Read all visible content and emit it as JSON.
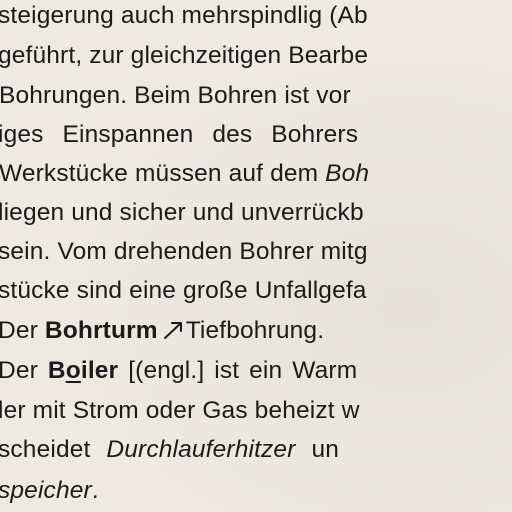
{
  "lines": [
    {
      "id": 0,
      "segments": [
        "steigerung auch mehrspindlig (Ab"
      ]
    },
    {
      "id": 1,
      "segments": [
        "geführt, zur gleichzeitigen Bearbe"
      ]
    },
    {
      "id": 2,
      "segments": [
        "Bohrungen. Beim Bohren ist vor"
      ]
    },
    {
      "id": 3,
      "segments": [
        "iges Einspannen des Bohrers"
      ]
    },
    {
      "id": 4,
      "segments": [
        "Werkstücke müssen auf dem ",
        "Boh"
      ]
    },
    {
      "id": 5,
      "segments": [
        "liegen und sicher und unverrückb"
      ]
    },
    {
      "id": 6,
      "segments": [
        "sein. Vom drehenden Bohrer mitg"
      ]
    },
    {
      "id": 7,
      "segments": [
        "stücke sind eine große Unfallgefa"
      ]
    },
    {
      "id": 8,
      "segments": [
        "Der ",
        "Bohrturm",
        "Tiefbohrung."
      ]
    },
    {
      "id": 9,
      "segments": [
        "Der ",
        "B",
        "o",
        "iler",
        " [(engl.] ist ein Warm"
      ]
    },
    {
      "id": 10,
      "segments": [
        "ler mit Strom oder Gas beheizt w"
      ]
    },
    {
      "id": 11,
      "segments": [
        "scheidet ",
        "Durchlauferhitzer",
        " un"
      ]
    },
    {
      "id": 12,
      "segments": [
        "speicher",
        "."
      ]
    }
  ]
}
